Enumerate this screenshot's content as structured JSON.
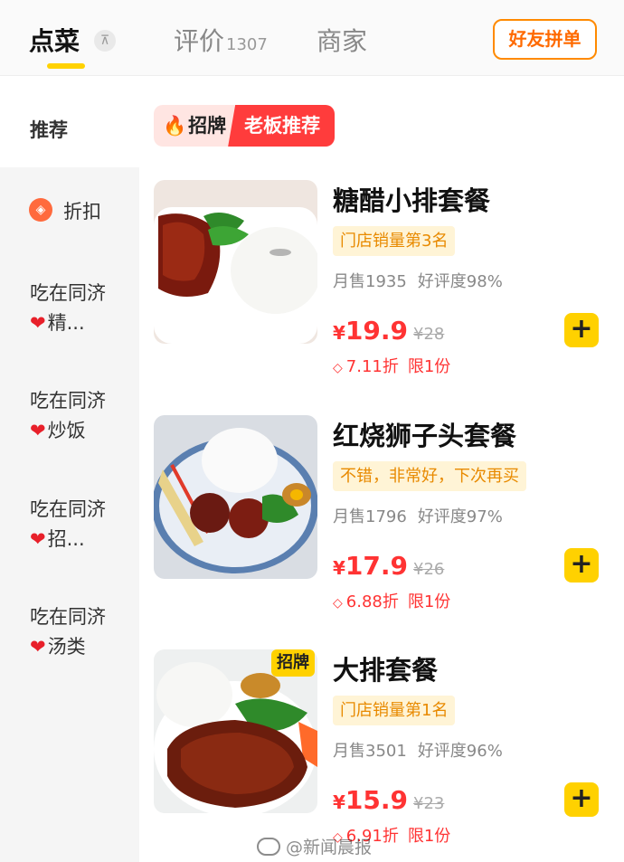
{
  "tabs": {
    "order": "点菜",
    "collapse_icon": "⊼",
    "reviews": "评价",
    "reviews_count": "1307",
    "merchant": "商家",
    "group_order": "好友拼单"
  },
  "sidebar": {
    "recommend": "推荐",
    "discount": "折扣",
    "categories": [
      {
        "line1": "吃在同济",
        "heart": "❤",
        "line2": "精..."
      },
      {
        "line1": "吃在同济",
        "heart": "❤",
        "line2": "炒饭"
      },
      {
        "line1": "吃在同济",
        "heart": "❤",
        "line2": "招..."
      },
      {
        "line1": "吃在同济",
        "heart": "❤",
        "line2": "汤类"
      }
    ]
  },
  "section_badge": {
    "left": "招牌",
    "right": "老板推荐"
  },
  "dishes": [
    {
      "name": "糖醋小排套餐",
      "tag": "门店销量第3名",
      "sales": "月售1935",
      "rating": "好评度98%",
      "currency": "¥",
      "price": "19.9",
      "original": "¥28",
      "discount": "7.11折",
      "limit": "限1份"
    },
    {
      "name": "红烧狮子头套餐",
      "tag": "不错，非常好，下次再买",
      "sales": "月售1796",
      "rating": "好评度97%",
      "currency": "¥",
      "price": "17.9",
      "original": "¥26",
      "discount": "6.88折",
      "limit": "限1份"
    },
    {
      "name": "大排套餐",
      "corner_badge": "招牌",
      "tag": "门店销量第1名",
      "sales": "月售3501",
      "rating": "好评度96%",
      "currency": "¥",
      "price": "15.9",
      "original": "¥23",
      "discount": "6.91折",
      "limit": "限1份"
    }
  ],
  "add_label": "+",
  "watermark": "@新闻晨报"
}
